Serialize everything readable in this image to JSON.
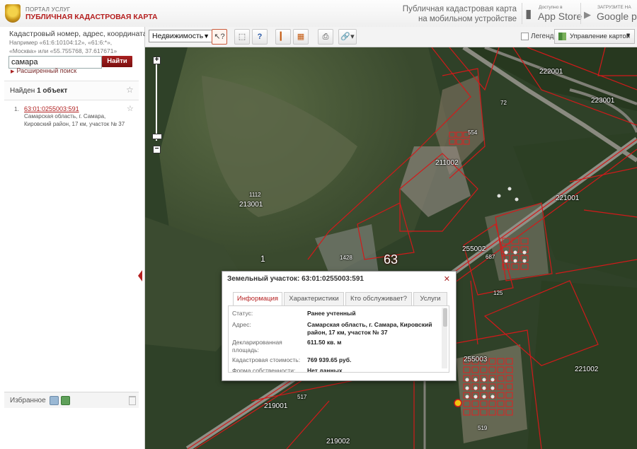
{
  "header": {
    "portal_small": "ПОРТАЛ УСЛУГ",
    "portal_title": "ПУБЛИЧНАЯ КАДАСТРОВАЯ КАРТА",
    "mobile_line1": "Публичная кадастровая карта",
    "mobile_line2": "на мобильном устройстве",
    "appstore_small": "Доступно в",
    "appstore_big": "App Store",
    "googleplay_small": "ЗАГРУЗИТЕ НА",
    "googleplay_big": "Google play"
  },
  "search": {
    "label": "Кадастровый номер, адрес, координата:",
    "hint": "Например «61:6:10104:12», «61:6:*», «Москва» или «55.755768, 37.617671»",
    "value": "самара",
    "button": "Найти",
    "advanced": "Расширенный поиск"
  },
  "results": {
    "found_prefix": "Найден",
    "found_count": "1 объект",
    "items": [
      {
        "num": "1.",
        "link": "63:01:0255003:591",
        "address": "Самарская область, г. Самара, Кировский район, 17 км, участок № 37"
      }
    ]
  },
  "favorites": {
    "label": "Избранное"
  },
  "toolbar": {
    "layer": "Недвижимость",
    "legend": "Легенда",
    "map_control": "Управление картой"
  },
  "map": {
    "labels": [
      "222001",
      "223001",
      "72",
      "554",
      "211002",
      "221001",
      "1112",
      "213001",
      "1",
      "63",
      "1428",
      "255002",
      "687",
      "125",
      "255003",
      "221002",
      "219001",
      "517",
      "219002",
      "519"
    ]
  },
  "popup": {
    "title": "Земельный участок: 63:01:0255003:591",
    "tabs": [
      "Информация",
      "Характеристики",
      "Кто обслуживает?",
      "Услуги"
    ],
    "props": [
      {
        "label": "Статус:",
        "value": "Ранее учтенный"
      },
      {
        "label": "Адрес:",
        "value": "Самарская область, г. Самара, Кировский район, 17 км, участок № 37"
      },
      {
        "label": "Декларированная площадь:",
        "value": "611.50 кв. м"
      },
      {
        "label": "Кадастровая стоимость:",
        "value": "769 939.65 руб."
      },
      {
        "label": "Форма собственности:",
        "value": "Нет данных"
      }
    ]
  }
}
